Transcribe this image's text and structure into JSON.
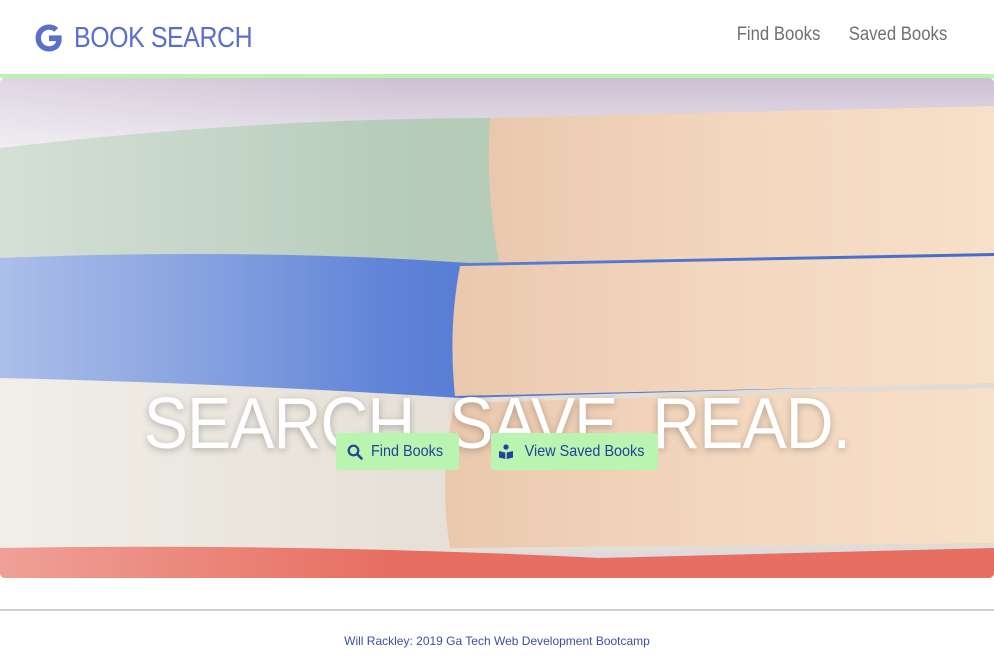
{
  "brand": {
    "logo_icon": "google-g-icon",
    "title": "BOOK SEARCH"
  },
  "nav": {
    "items": [
      {
        "label": "Find Books"
      },
      {
        "label": "Saved Books"
      }
    ]
  },
  "hero": {
    "title": "SEARCH. SAVE. READ.",
    "buttons": {
      "find": {
        "icon": "search-icon",
        "label": "Find Books"
      },
      "saved": {
        "icon": "book-reader-icon",
        "label": "View Saved Books"
      }
    }
  },
  "footer": {
    "text": "Will Rackley: 2019 Ga Tech Web Development Bootcamp"
  },
  "colors": {
    "brand": "#5a6fcc",
    "accent": "#b9f5b0",
    "button_text": "#26409b",
    "nav_text": "#6f6f78"
  }
}
